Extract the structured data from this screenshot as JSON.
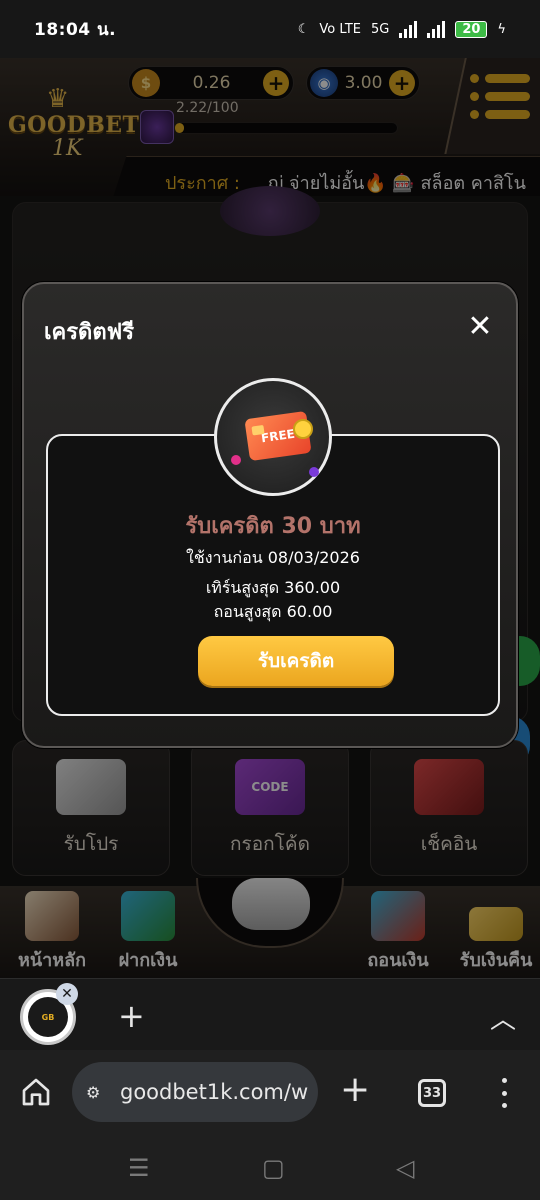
{
  "status_bar": {
    "time": "18:04 น.",
    "network_label": "Vo LTE",
    "network_5g": "5G",
    "battery": "20"
  },
  "header": {
    "logo_text": "GOODBET",
    "logo_sub": "1K",
    "coin_balance": "0.26",
    "gem_balance": "3.00",
    "level_progress_text": "2.22/100",
    "level_progress_fraction": 0.022,
    "announcement_label": "ประกาศ :",
    "announcement_text": "ญ่ จ่ายไม่อั้น🔥 🎰 สล็อต คาสิโน"
  },
  "features": [
    {
      "label": "รับโปร",
      "icon": "megaphone-icon"
    },
    {
      "label": "กรอกโค้ด",
      "icon": "code-ticket-icon"
    },
    {
      "label": "เช็คอิน",
      "icon": "calendar-icon"
    }
  ],
  "feature_art_text": "CODE",
  "bottom_nav": [
    {
      "label": "หน้าหลัก",
      "icon": "home-icon"
    },
    {
      "label": "ฝากเงิน",
      "icon": "deposit-icon"
    },
    {
      "label": "ถอนเงิน",
      "icon": "withdraw-icon"
    },
    {
      "label": "รับเงินคืน",
      "icon": "cashback-icon"
    }
  ],
  "modal": {
    "title": "เครดิตฟรี",
    "badge_text": "FREE",
    "headline": "รับเครดิต 30 บาท",
    "use_before": "ใช้งานก่อน 08/03/2026",
    "max_turnover": "เทิร์นสูงสุด 360.00",
    "max_withdraw": "ถอนสูงสุด 60.00",
    "claim_button": "รับเครดิต"
  },
  "browser": {
    "url": "goodbet1k.com/w",
    "tab_count": "33"
  },
  "colors": {
    "accent_gold": "#e3ad23",
    "headline_rose": "#b3736a"
  }
}
